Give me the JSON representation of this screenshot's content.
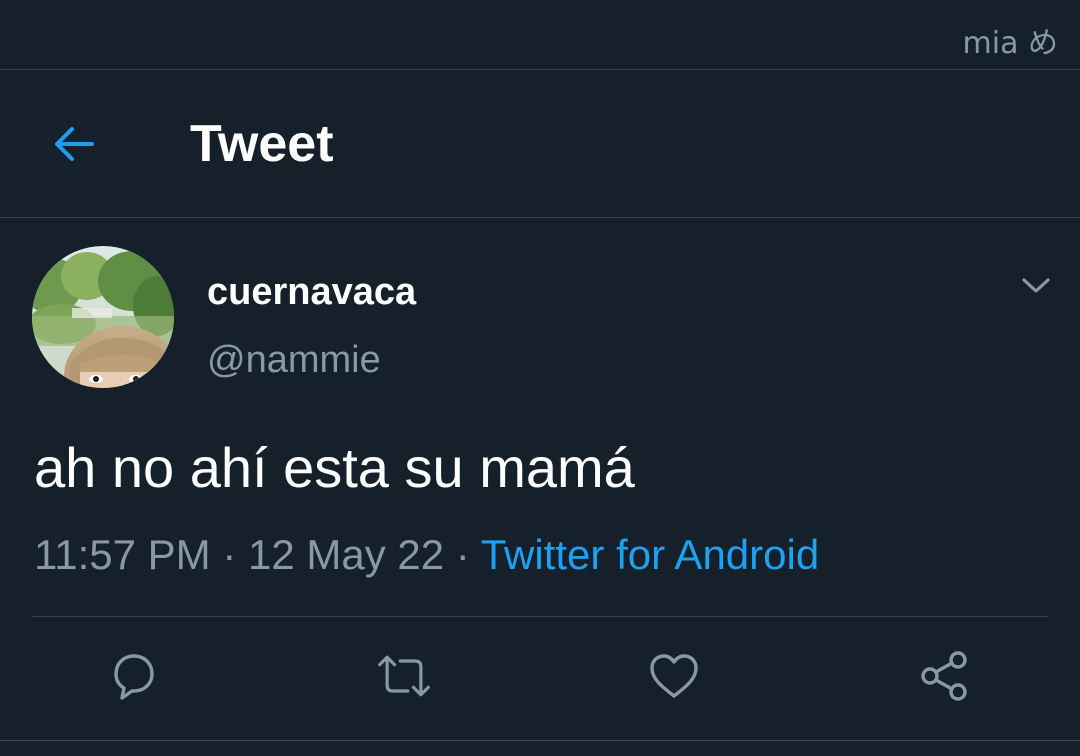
{
  "status_bar": {
    "text": "mia め"
  },
  "header": {
    "title": "Tweet",
    "back_icon": "arrow-left-icon",
    "accent_color": "#1da1f2"
  },
  "tweet": {
    "display_name": "cuernavaca",
    "handle": "@nammie",
    "text": "ah no ahí esta su mamá",
    "time": "11:57 PM",
    "separator": "·",
    "date": "12 May 22",
    "source": "Twitter for Android",
    "menu_icon": "chevron-down-icon"
  },
  "actions": [
    {
      "name": "reply",
      "icon": "speech-bubble-icon"
    },
    {
      "name": "retweet",
      "icon": "retweet-icon"
    },
    {
      "name": "like",
      "icon": "heart-icon"
    },
    {
      "name": "share",
      "icon": "share-icon"
    }
  ],
  "colors": {
    "background": "#15202b",
    "primary_text": "#ffffff",
    "secondary_text": "#8899a6",
    "divider": "#38444d",
    "link": "#1da1f2"
  }
}
